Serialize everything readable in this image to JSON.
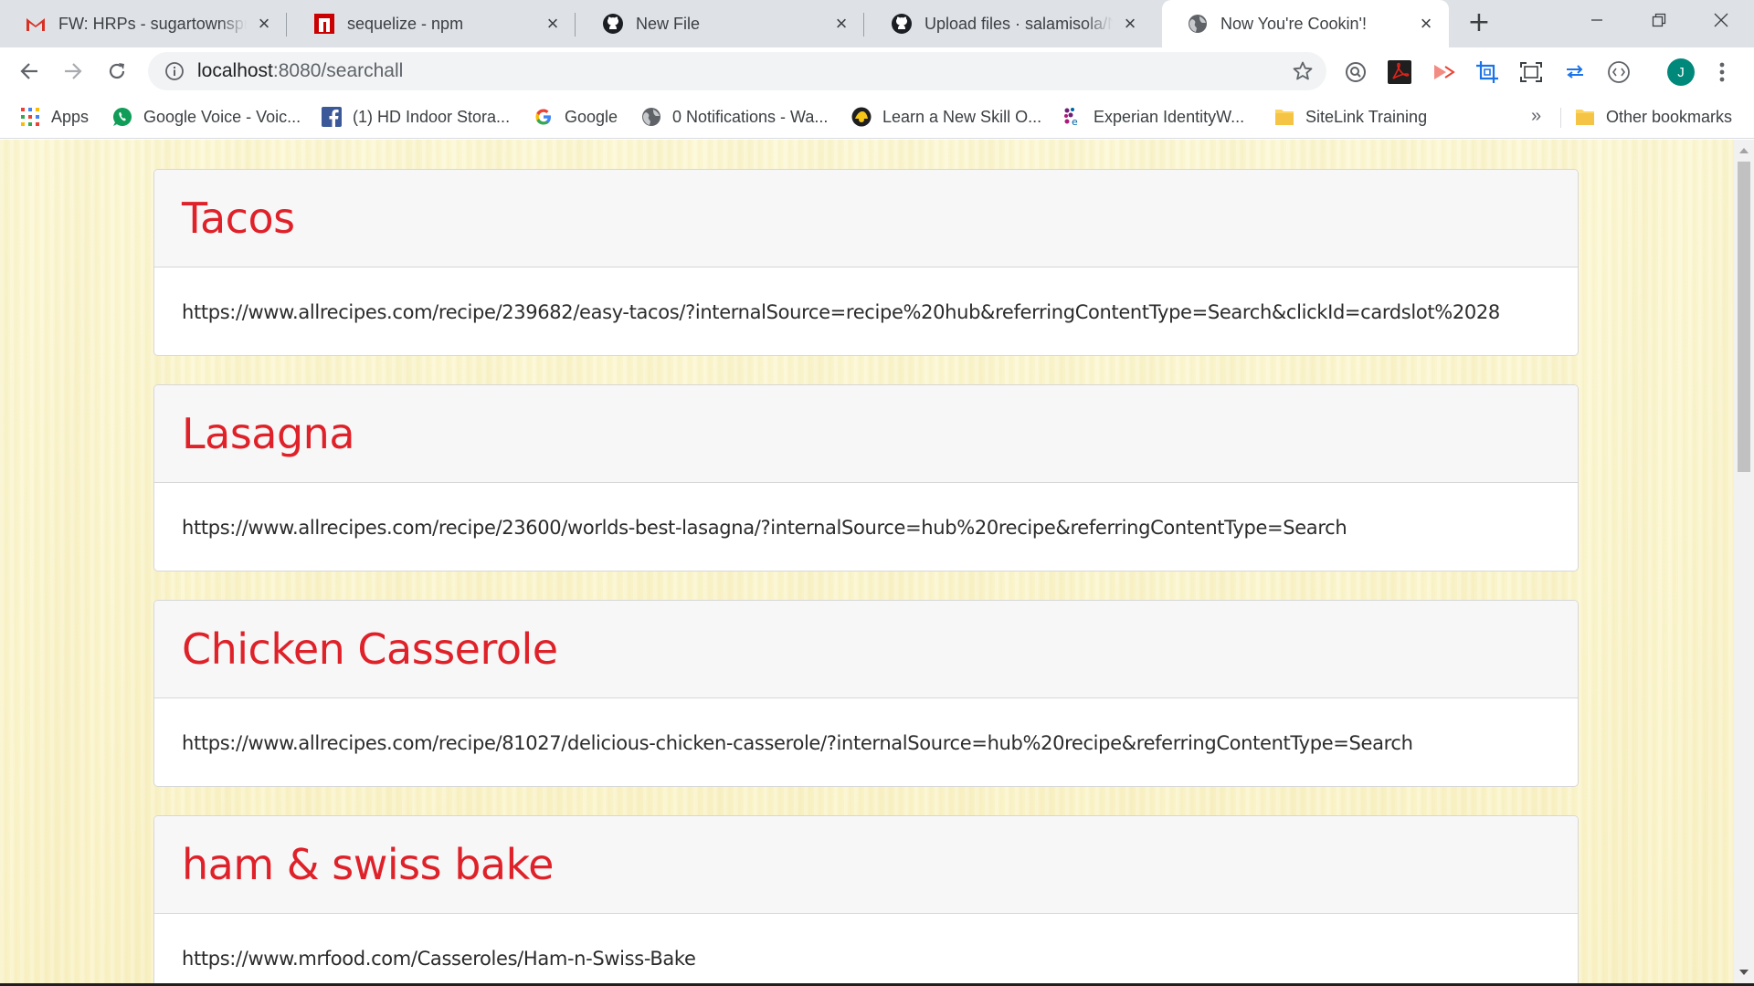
{
  "browser": {
    "tabs": [
      {
        "title": "FW: HRPs - sugartownsprings",
        "icon": "gmail-icon",
        "active": false
      },
      {
        "title": "sequelize - npm",
        "icon": "npm-icon",
        "active": false
      },
      {
        "title": "New File",
        "icon": "github-icon",
        "active": false
      },
      {
        "title": "Upload files · salamisola/No",
        "icon": "github-icon",
        "active": false
      },
      {
        "title": "Now You're Cookin'!",
        "icon": "globe-icon",
        "active": true
      }
    ],
    "address": {
      "host": "localhost",
      "path": ":8080/searchall"
    },
    "profile_initial": "J",
    "bookmarks": [
      {
        "label": "Apps",
        "icon": "apps-grid-icon"
      },
      {
        "label": "Google Voice - Voic...",
        "icon": "google-voice-icon"
      },
      {
        "label": "(1) HD Indoor Stora...",
        "icon": "facebook-icon"
      },
      {
        "label": "Google",
        "icon": "google-icon"
      },
      {
        "label": "0 Notifications - Wa...",
        "icon": "globe-icon"
      },
      {
        "label": "Learn a New Skill O...",
        "icon": "lynda-icon"
      },
      {
        "label": "Experian IdentityW...",
        "icon": "experian-icon"
      },
      {
        "label": "SiteLink Training",
        "icon": "folder-icon"
      }
    ],
    "bookmarks_more": "»",
    "other_bookmarks": "Other bookmarks"
  },
  "recipes": [
    {
      "name": "Tacos",
      "url": "https://www.allrecipes.com/recipe/239682/easy-tacos/?internalSource=recipe%20hub&referringContentType=Search&clickId=cardslot%2028"
    },
    {
      "name": "Lasagna",
      "url": "https://www.allrecipes.com/recipe/23600/worlds-best-lasagna/?internalSource=hub%20recipe&referringContentType=Search"
    },
    {
      "name": "Chicken Casserole",
      "url": "https://www.allrecipes.com/recipe/81027/delicious-chicken-casserole/?internalSource=hub%20recipe&referringContentType=Search"
    },
    {
      "name": "ham & swiss bake",
      "url": "https://www.mrfood.com/Casseroles/Ham-n-Swiss-Bake"
    }
  ],
  "colors": {
    "title_red": "#df2129",
    "page_bg": "#fbf6cf"
  }
}
